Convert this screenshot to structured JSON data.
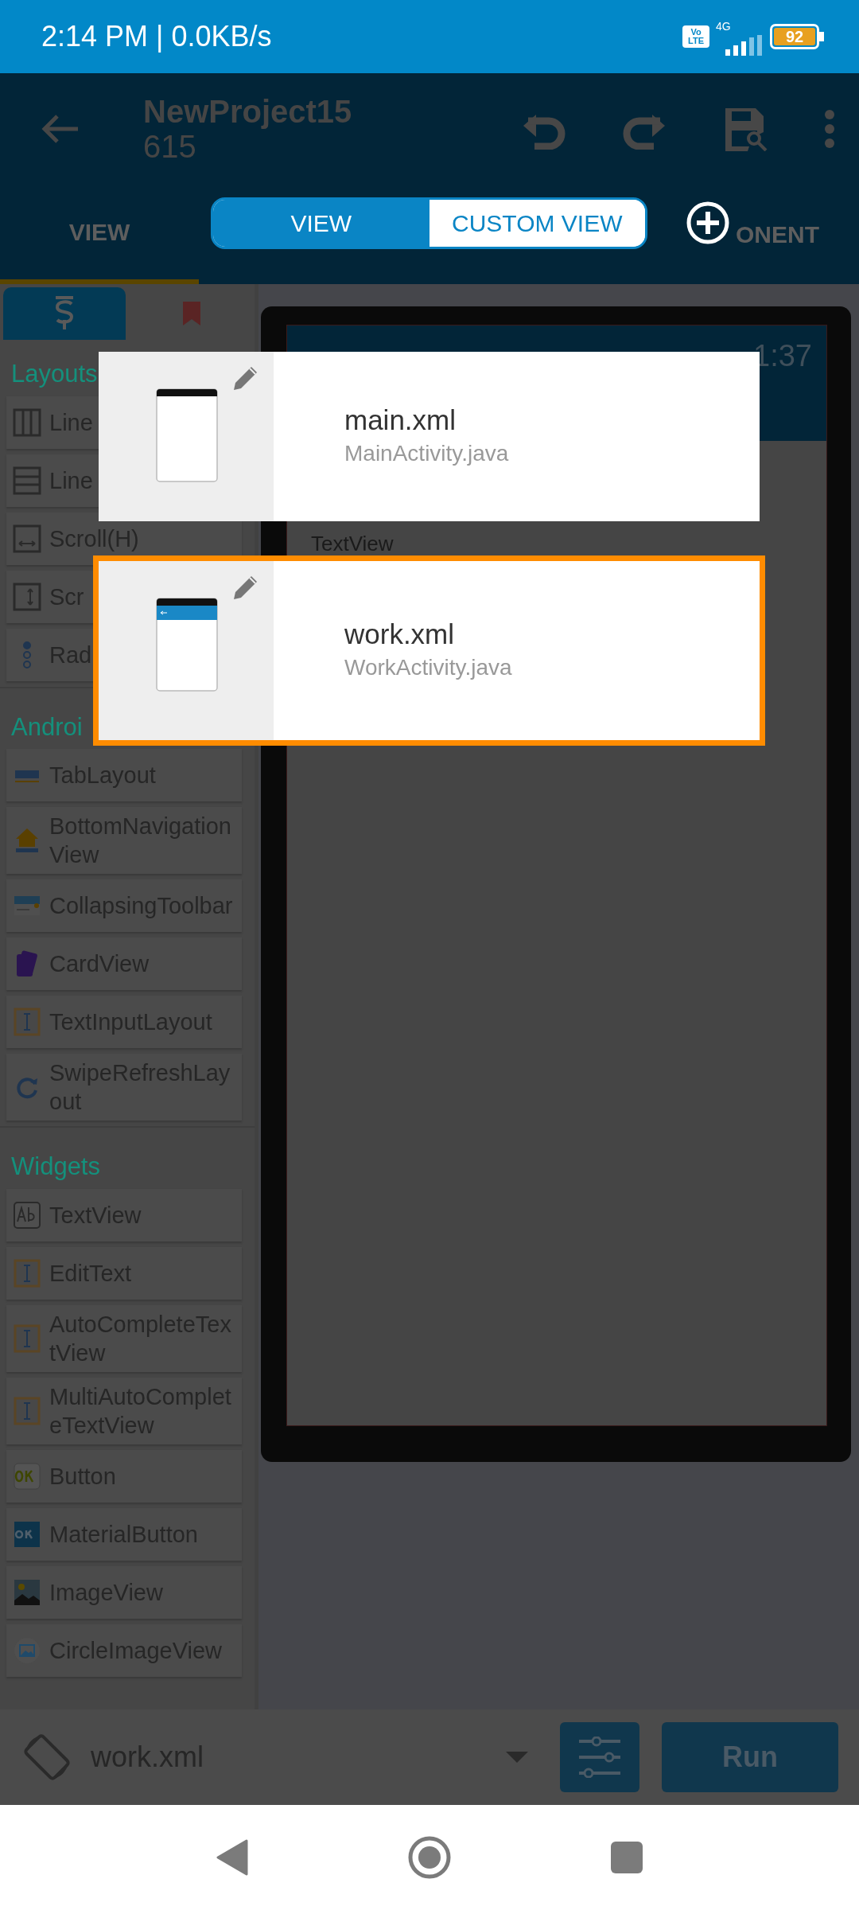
{
  "status_bar": {
    "time": "2:14 PM | 0.0KB/s",
    "volte": [
      "Vo",
      "LTE"
    ],
    "network": "4G",
    "battery": "92"
  },
  "app_bar": {
    "title": "NewProject15",
    "subtitle": "615"
  },
  "tabs": [
    {
      "label": "VIEW",
      "selected": true
    },
    {
      "label": "ONENT",
      "selected": false
    }
  ],
  "palette": {
    "tabs": [
      {
        "kind": "source",
        "selected": true
      },
      {
        "kind": "bookmark",
        "selected": false
      }
    ],
    "sections": [
      {
        "title": "Layouts",
        "items": [
          {
            "label": "Line",
            "kind": "columns"
          },
          {
            "label": "Line",
            "kind": "rows"
          },
          {
            "label": "Scroll(H)",
            "kind": "hscroll"
          },
          {
            "label": "Scr",
            "kind": "vscroll"
          },
          {
            "label": "Rad",
            "kind": "radio"
          }
        ]
      },
      {
        "title": "Androi",
        "items": [
          {
            "label": "TabLayout",
            "kind": "tab"
          },
          {
            "label": "BottomNavigationView",
            "kind": "home"
          },
          {
            "label": "CollapsingToolbar",
            "kind": "toolbar"
          },
          {
            "label": "CardView",
            "kind": "card"
          },
          {
            "label": "TextInputLayout",
            "kind": "input"
          },
          {
            "label": "SwipeRefreshLayout",
            "kind": "refresh"
          }
        ]
      },
      {
        "title": "Widgets",
        "items": [
          {
            "label": "TextView",
            "kind": "text"
          },
          {
            "label": "EditText",
            "kind": "input"
          },
          {
            "label": "AutoCompleteTextView",
            "kind": "input"
          },
          {
            "label": "MultiAutoCompleteTextView",
            "kind": "input"
          },
          {
            "label": "Button",
            "kind": "ok"
          },
          {
            "label": "MaterialButton",
            "kind": "okfilled"
          },
          {
            "label": "ImageView",
            "kind": "image"
          },
          {
            "label": "CircleImageView",
            "kind": "circleimage"
          }
        ]
      }
    ]
  },
  "preview": {
    "time": "1:37",
    "text": "TextView"
  },
  "bottom_bar": {
    "file": "work.xml",
    "run": "Run"
  },
  "popup": {
    "toggle": [
      {
        "label": "VIEW",
        "selected": true
      },
      {
        "label": "CUSTOM VIEW",
        "selected": false
      }
    ],
    "files": [
      {
        "name": "main.xml",
        "activity": "MainActivity.java",
        "toolbar": false,
        "selected": false
      },
      {
        "name": "work.xml",
        "activity": "WorkActivity.java",
        "toolbar": true,
        "selected": true
      }
    ]
  }
}
